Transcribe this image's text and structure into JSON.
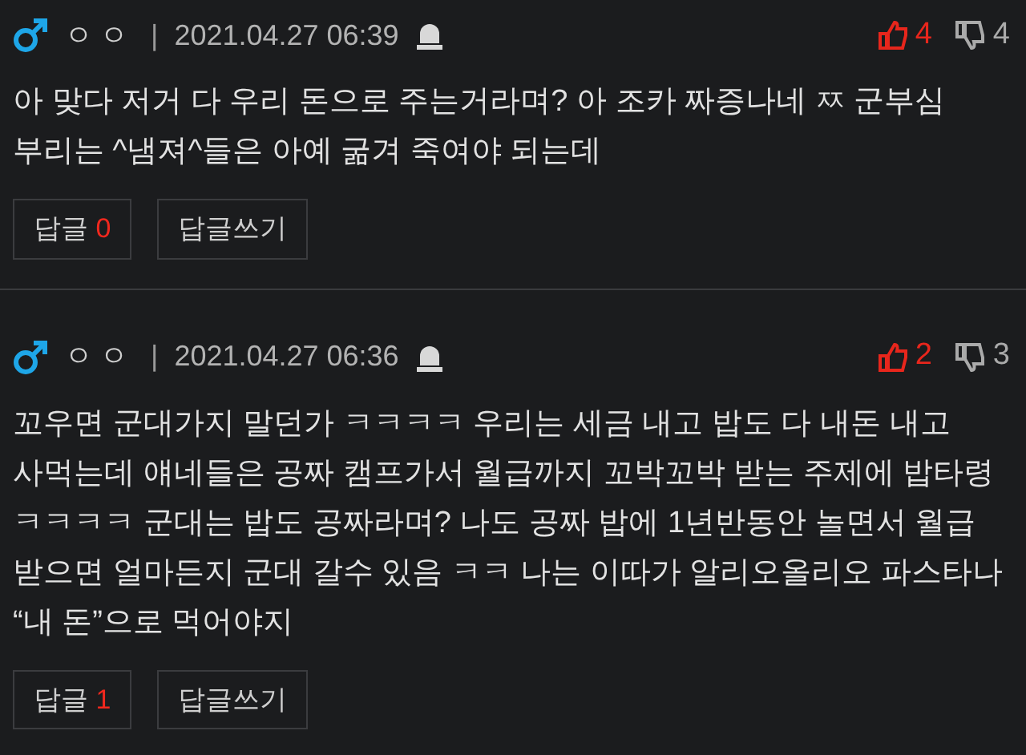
{
  "comments": [
    {
      "username": "ㅇㅇ",
      "separator": "|",
      "date": "2021.04.27 06:39",
      "likes": "4",
      "dislikes": "4",
      "body": "아 맞다 저거 다 우리 돈으로 주는거라며? 아 조카 짜증나네 ㅉ 군부심 부리는 ^냄져^들은 아예 굶겨 죽여야 되는데",
      "reply_label": "답글",
      "reply_count": "0",
      "write_reply": "답글쓰기"
    },
    {
      "username": "ㅇㅇ",
      "separator": "|",
      "date": "2021.04.27 06:36",
      "likes": "2",
      "dislikes": "3",
      "body": "꼬우면 군대가지 말던가 ㅋㅋㅋㅋ 우리는 세금 내고 밥도 다 내돈 내고 사먹는데 얘네들은 공짜 캠프가서 월급까지 꼬박꼬박 받는 주제에 밥타령 ㅋㅋㅋㅋ 군대는 밥도 공짜라며? 나도 공짜 밥에 1년반동안 놀면서 월급 받으면 얼마든지 군대 갈수 있음 ㅋㅋ 나는 이따가 알리오올리오 파스타나 “내 돈”으로 먹어야지",
      "reply_label": "답글",
      "reply_count": "1",
      "write_reply": "답글쓰기"
    }
  ]
}
